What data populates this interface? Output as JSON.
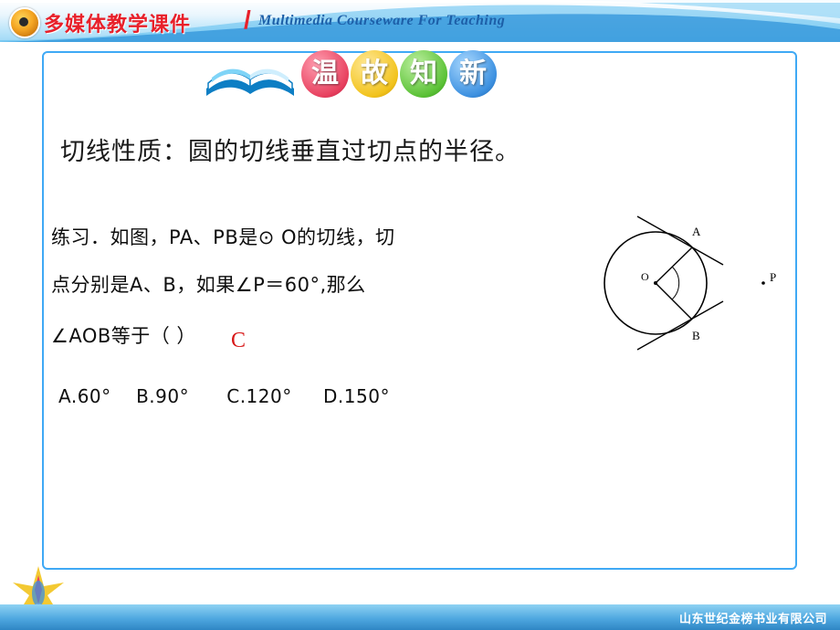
{
  "banner": {
    "title_cn": "多媒体教学课件",
    "slash": "/",
    "title_en": "Multimedia Courseware For Teaching",
    "logo_icon": "orange-eye-logo-icon"
  },
  "slide": {
    "title_chars": [
      "温",
      "故",
      "知",
      "新"
    ],
    "book_icon": "open-book-icon",
    "property_line": "切线性质：圆的切线垂直过切点的半径。",
    "exercise": {
      "line1": "练习．如图，PA、PB是⊙ O的切线，切",
      "line2": "点分别是A、B，如果∠P＝60°,那么",
      "line3": "∠AOB等于（            ）",
      "answer": "C",
      "options": "A.60°    B.90°      C.120°     D.150°"
    },
    "figure": {
      "label_a": "A",
      "label_b": "B",
      "label_o": "O",
      "label_p": "P"
    }
  },
  "footer": {
    "text": "山东世纪金榜书业有限公司"
  },
  "colors": {
    "frame_border": "#3fa9f5",
    "banner_red": "#e8202a",
    "banner_blue": "#1d5fa8",
    "answer_red": "#d81a1a",
    "footer_blue": "#2f86c4"
  }
}
